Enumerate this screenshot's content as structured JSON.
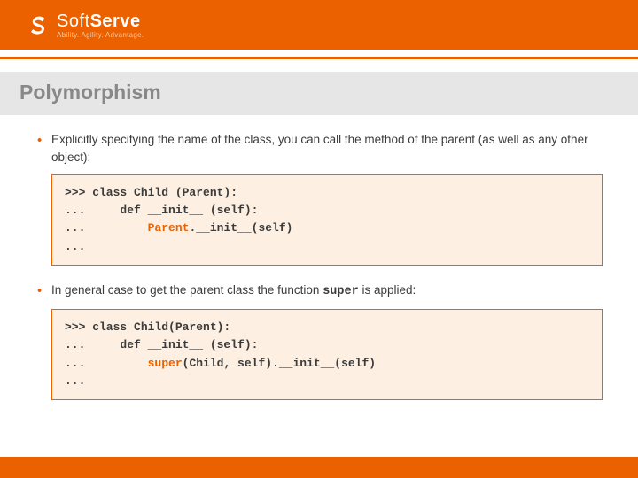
{
  "brand": {
    "name_light": "Soft",
    "name_bold": "Serve",
    "tagline": "Ability. Agility. Advantage."
  },
  "slide": {
    "title": "Polymorphism"
  },
  "bullets": {
    "b1_pre": "Explicitly specifying the name of the class, you can call the method of the parent (as well as any other object):",
    "b2_pre": "In general case to get the parent class the function ",
    "b2_mono": "super",
    "b2_post": " is applied:"
  },
  "code1": {
    "l1": ">>> class Child (Parent):",
    "l2": "...     def __init__ (self):",
    "l3a": "...         ",
    "l3hl": "Parent",
    "l3b": ".__init__(self)",
    "l4": "..."
  },
  "code2": {
    "l1": ">>> class Child(Parent):",
    "l2": "...     def __init__ (self):",
    "l3a": "...         ",
    "l3hl": "super",
    "l3b": "(Child, self).__init__(self)",
    "l4": "..."
  }
}
